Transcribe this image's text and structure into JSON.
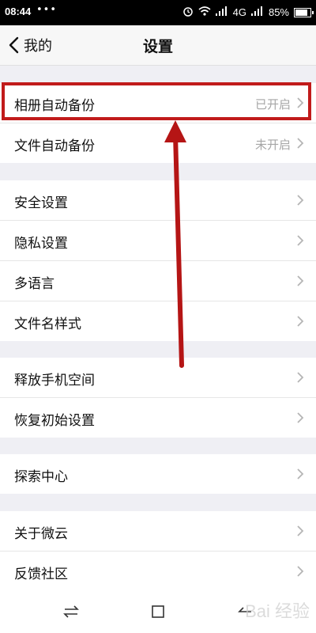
{
  "statusbar": {
    "time": "08:44",
    "dots": "•••",
    "network": "4G",
    "battery_percent": "85%"
  },
  "navbar": {
    "back_label": "我的",
    "title": "设置"
  },
  "sections": [
    {
      "items": [
        {
          "label": "相册自动备份",
          "value": "已开启"
        },
        {
          "label": "文件自动备份",
          "value": "未开启"
        }
      ]
    },
    {
      "items": [
        {
          "label": "安全设置"
        },
        {
          "label": "隐私设置"
        },
        {
          "label": "多语言"
        },
        {
          "label": "文件名样式"
        }
      ]
    },
    {
      "items": [
        {
          "label": "释放手机空间"
        },
        {
          "label": "恢复初始设置"
        }
      ]
    },
    {
      "items": [
        {
          "label": "探索中心"
        }
      ]
    },
    {
      "items": [
        {
          "label": "关于微云"
        },
        {
          "label": "反馈社区"
        }
      ]
    }
  ],
  "watermark": "Bai 经验",
  "colors": {
    "highlight": "#c11b1b",
    "chevron": "#b5b5b5"
  }
}
